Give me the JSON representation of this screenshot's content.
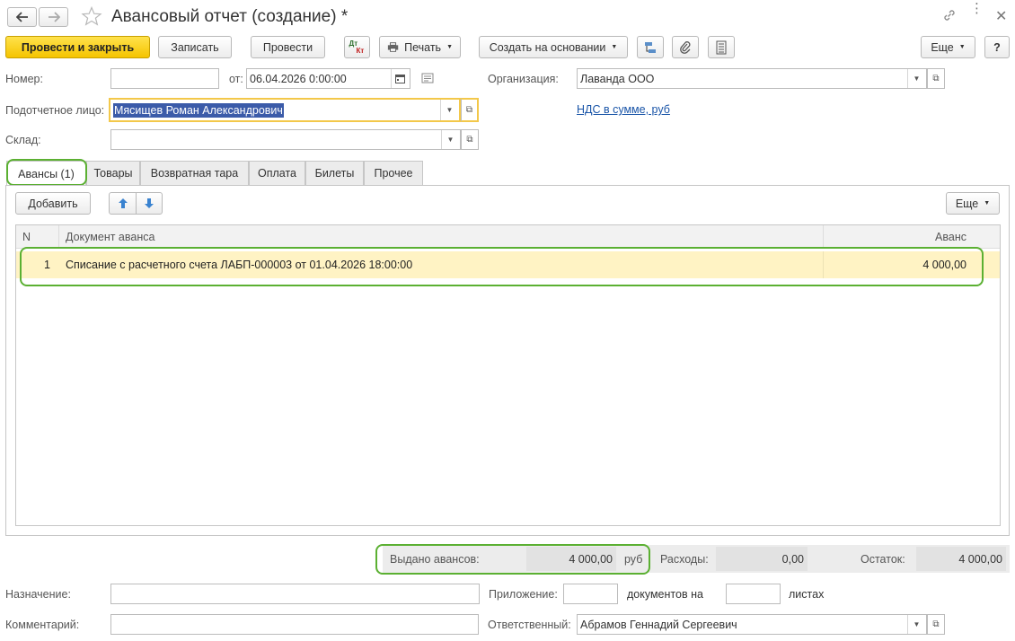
{
  "window": {
    "title": "Авансовый отчет (создание) *"
  },
  "toolbar": {
    "post_and_close": "Провести и закрыть",
    "save": "Записать",
    "post": "Провести",
    "dtkt_top": "Дт",
    "dtkt_bottom": "Кт",
    "print": "Печать",
    "create_based_on": "Создать на основании",
    "more": "Еще",
    "help": "?"
  },
  "form": {
    "number_label": "Номер:",
    "number_value": "",
    "date_label": "от:",
    "date_value": "06.04.2026  0:00:00",
    "organization_label": "Организация:",
    "organization_value": "Лаванда ООО",
    "accountable_label": "Подотчетное лицо:",
    "accountable_value": "Мясищев Роман Александрович",
    "vat_link": "НДС в сумме, руб",
    "warehouse_label": "Склад:",
    "warehouse_value": ""
  },
  "tabs": [
    {
      "label": "Авансы (1)"
    },
    {
      "label": "Товары"
    },
    {
      "label": "Возвратная тара"
    },
    {
      "label": "Оплата"
    },
    {
      "label": "Билеты"
    },
    {
      "label": "Прочее"
    }
  ],
  "table_toolbar": {
    "add": "Добавить",
    "more": "Еще"
  },
  "table": {
    "columns": {
      "n": "N",
      "document": "Документ аванса",
      "advance": "Аванс"
    },
    "rows": [
      {
        "n": "1",
        "document": "Списание с расчетного счета ЛАБП-000003 от 01.04.2026 18:00:00",
        "advance": "4 000,00"
      }
    ]
  },
  "totals": {
    "issued_label": "Выдано авансов:",
    "issued_value": "4 000,00",
    "currency": "руб",
    "expenses_label": "Расходы:",
    "expenses_value": "0,00",
    "balance_label": "Остаток:",
    "balance_value": "4 000,00"
  },
  "footer": {
    "purpose_label": "Назначение:",
    "purpose_value": "",
    "attachment_label": "Приложение:",
    "attachment_value": "",
    "docs_on": "документов на",
    "sheets_value": "",
    "sheets": "листах",
    "comment_label": "Комментарий:",
    "comment_value": "",
    "responsible_label": "Ответственный:",
    "responsible_value": "Абрамов Геннадий Сергеевич"
  },
  "colors": {
    "accent_yellow": "#f5c400",
    "highlight_green": "#5bb032",
    "row_selected": "#fff3c4",
    "link": "#1a55a8"
  }
}
